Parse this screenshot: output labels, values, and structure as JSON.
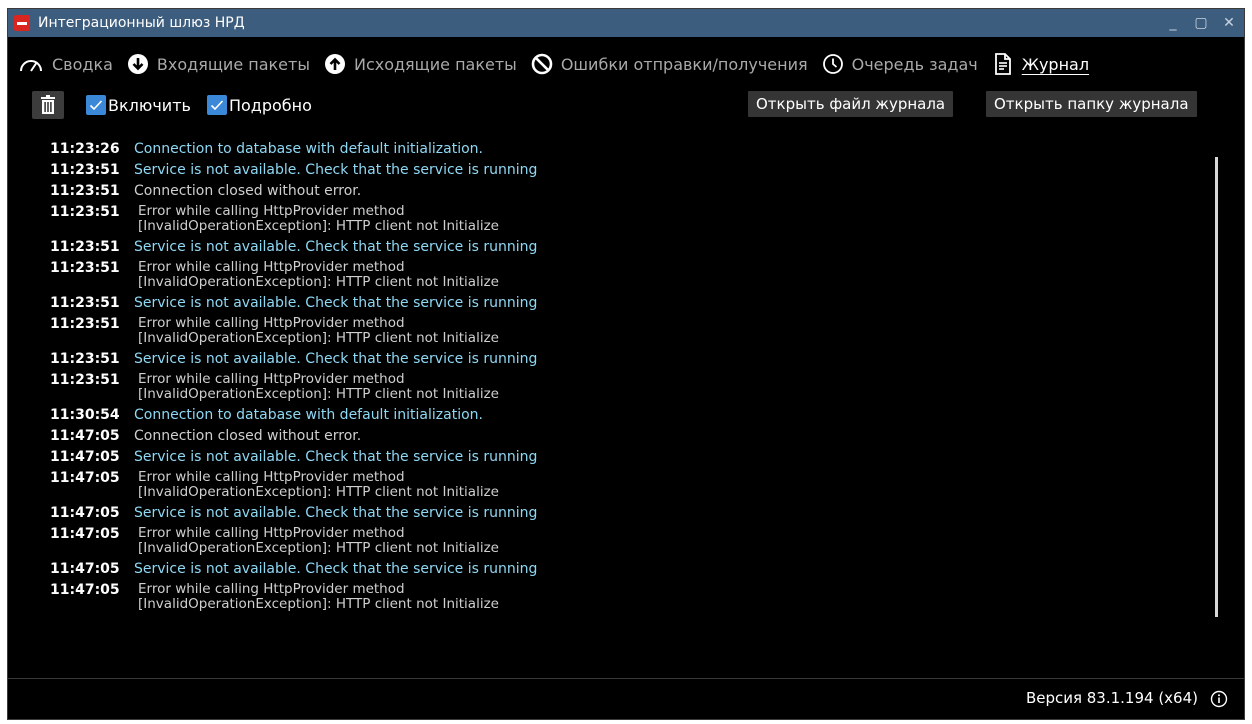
{
  "window": {
    "title": "Интеграционный шлюз НРД",
    "controls": {
      "minimize": "_",
      "maximize": "▢",
      "close": "✕"
    }
  },
  "tabs": [
    {
      "label": "Сводка",
      "icon": "gauge-icon",
      "active": false
    },
    {
      "label": "Входящие пакеты",
      "icon": "arrow-down-circle-icon",
      "active": false
    },
    {
      "label": "Исходящие пакеты",
      "icon": "arrow-up-circle-icon",
      "active": false
    },
    {
      "label": "Ошибки отправки/получения",
      "icon": "no-entry-icon",
      "active": false
    },
    {
      "label": "Очередь задач",
      "icon": "clock-icon",
      "active": false
    },
    {
      "label": "Журнал",
      "icon": "document-icon",
      "active": true
    }
  ],
  "toolbar": {
    "enable_label": "Включить",
    "verbose_label": "Подробно",
    "open_file_label": "Открыть файл журнала",
    "open_folder_label": "Открыть папку журнала"
  },
  "log": [
    {
      "time": "11:23:26",
      "text": "Connection to database with default initialization.",
      "level": "info"
    },
    {
      "time": "11:23:51",
      "text": "Service is not available. Check that the service is running",
      "level": "info"
    },
    {
      "time": "11:23:51",
      "text": "Connection closed without error.",
      "level": "normal"
    },
    {
      "time": "11:23:51",
      "text": "Error while calling HttpProvider method\n[InvalidOperationException]: HTTP client not Initialize",
      "level": "normal"
    },
    {
      "time": "11:23:51",
      "text": "Service is not available. Check that the service is running",
      "level": "info"
    },
    {
      "time": "11:23:51",
      "text": "Error while calling HttpProvider method\n[InvalidOperationException]: HTTP client not Initialize",
      "level": "normal"
    },
    {
      "time": "11:23:51",
      "text": "Service is not available. Check that the service is running",
      "level": "info"
    },
    {
      "time": "11:23:51",
      "text": "Error while calling HttpProvider method\n[InvalidOperationException]: HTTP client not Initialize",
      "level": "normal"
    },
    {
      "time": "11:23:51",
      "text": "Service is not available. Check that the service is running",
      "level": "info"
    },
    {
      "time": "11:23:51",
      "text": "Error while calling HttpProvider method\n[InvalidOperationException]: HTTP client not Initialize",
      "level": "normal"
    },
    {
      "time": "11:30:54",
      "text": "Connection to database with default initialization.",
      "level": "info"
    },
    {
      "time": "11:47:05",
      "text": "Connection closed without error.",
      "level": "normal"
    },
    {
      "time": "11:47:05",
      "text": "Service is not available. Check that the service is running",
      "level": "info"
    },
    {
      "time": "11:47:05",
      "text": "Error while calling HttpProvider method\n[InvalidOperationException]: HTTP client not Initialize",
      "level": "normal"
    },
    {
      "time": "11:47:05",
      "text": "Service is not available. Check that the service is running",
      "level": "info"
    },
    {
      "time": "11:47:05",
      "text": "Error while calling HttpProvider method\n[InvalidOperationException]: HTTP client not Initialize",
      "level": "normal"
    },
    {
      "time": "11:47:05",
      "text": "Service is not available. Check that the service is running",
      "level": "info"
    },
    {
      "time": "11:47:05",
      "text": "Error while calling HttpProvider method\n[InvalidOperationException]: HTTP client not Initialize",
      "level": "normal"
    }
  ],
  "status": {
    "version": "Версия 83.1.194 (x64)"
  },
  "colors": {
    "titlebar": "#3d5d7e",
    "checkbox": "#3b88d9",
    "info_text": "#8fd8f4",
    "normal_text": "#cfcfcf"
  }
}
